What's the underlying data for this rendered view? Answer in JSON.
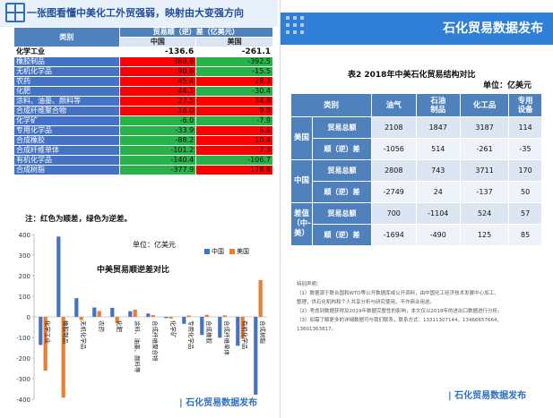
{
  "left_panel": {
    "title": "一张图看懂中美化工外贸强弱，映射由大变强方向",
    "table": {
      "category_header": "类别",
      "group_header": "贸易顺（逆）差（亿美元）",
      "col_china": "中国",
      "col_us": "美国",
      "rows": [
        {
          "cat": "化学工业",
          "cn": "-136.6",
          "us": "-261.1"
        },
        {
          "cat": "橡胶制品",
          "cn": "389.9",
          "us": "-392.5"
        },
        {
          "cat": "无机化学品",
          "cn": "90.6",
          "us": "-15.5"
        },
        {
          "cat": "农药",
          "cn": "45.4",
          "us": "28.3"
        },
        {
          "cat": "化肥",
          "cn": "44.1",
          "us": "-30.4"
        },
        {
          "cat": "涂料、油墨、颜料等",
          "cn": "27.5",
          "us": "34.8"
        },
        {
          "cat": "合成纤维聚合物",
          "cn": "16.0",
          "us": "9.0"
        },
        {
          "cat": "化学矿",
          "cn": "-6.0",
          "us": "-7.9"
        },
        {
          "cat": "专用化学品",
          "cn": "-33.9",
          "us": "6.6"
        },
        {
          "cat": "合成橡胶",
          "cn": "-88.2",
          "us": "10.4"
        },
        {
          "cat": "合成纤维单体",
          "cn": "-101.2",
          "us": "7.3"
        },
        {
          "cat": "有机化学品",
          "cn": "-140.4",
          "us": "-106.7"
        },
        {
          "cat": "合成树脂",
          "cn": "-377.9",
          "us": "178.8"
        }
      ]
    },
    "note": "注：红色为顺差，绿色为逆差。",
    "footer": "| 石化贸易数据发布"
  },
  "chart_data": {
    "type": "bar",
    "title": "中美贸易顺逆差对比",
    "unit": "单位：亿美元",
    "categories": [
      "化学工业",
      "橡胶制品",
      "无机化学品",
      "农药",
      "化肥",
      "涂料、油墨、颜料等",
      "合成纤维聚合物",
      "化学矿",
      "专用化学品",
      "合成橡胶",
      "合成纤维单体",
      "有机化学品",
      "合成树脂"
    ],
    "series": [
      {
        "name": "中国",
        "color": "#4472c4",
        "values": [
          -136.6,
          389.9,
          90.6,
          45.4,
          44.1,
          27.5,
          16.0,
          -6.0,
          -33.9,
          -88.2,
          -101.2,
          -140.4,
          -377.9
        ]
      },
      {
        "name": "美国",
        "color": "#ed7d31",
        "values": [
          -261.1,
          -392.5,
          -15.5,
          28.3,
          -30.4,
          34.8,
          9.0,
          -7.9,
          6.6,
          10.4,
          7.3,
          -106.7,
          178.8
        ]
      }
    ],
    "ylim": [
      -400,
      400
    ],
    "yticks": [
      400,
      300,
      200,
      100,
      0,
      -100,
      -200,
      -300,
      -400
    ],
    "grid": false,
    "legend": "top-right"
  },
  "right_panel": {
    "banner_title": "石化贸易数据发布",
    "caption": "表2  2018年中美石化贸易结构对比",
    "unit": "单位：亿美元",
    "table": {
      "header_category": "类别",
      "columns": [
        "油气",
        "石油\n制品",
        "化工品",
        "专用\n设备"
      ],
      "groups": [
        {
          "region": "美国",
          "rows": [
            {
              "metric": "贸易总额",
              "values": [
                "2108",
                "1847",
                "3187",
                "114"
              ]
            },
            {
              "metric": "顺（逆）差",
              "values": [
                "-1056",
                "514",
                "-261",
                "-35"
              ]
            }
          ]
        },
        {
          "region": "中国",
          "rows": [
            {
              "metric": "贸易总额",
              "values": [
                "2808",
                "743",
                "3711",
                "170"
              ]
            },
            {
              "metric": "顺（逆）差",
              "values": [
                "-2749",
                "24",
                "-137",
                "50"
              ]
            }
          ]
        },
        {
          "region": "差值\n（中-\n美）",
          "rows": [
            {
              "metric": "贸易总额",
              "values": [
                "700",
                "-1104",
                "524",
                "57"
              ]
            },
            {
              "metric": "顺（逆）差",
              "values": [
                "-1694",
                "-490",
                "125",
                "85"
              ]
            }
          ]
        }
      ]
    },
    "special_note_title": "特别声明：",
    "special_notes": [
      "（1）数据源于联合国和WTO等公开数据库或公开资料，由中国化工经济技术发展中心加工、",
      "整理，供石化机构和个人共享分析与研究使用，不作商业用途。",
      "（2）考虑到数据获得及2019年数据完整性的影响，本文仅以2018年的进出口数据进行分析。",
      "（3）如需了解更多的详细数据可与我们联系，联系方式：13311307144，13466657664，",
      "13601363817。"
    ],
    "footer": "| 石化贸易数据发布"
  }
}
